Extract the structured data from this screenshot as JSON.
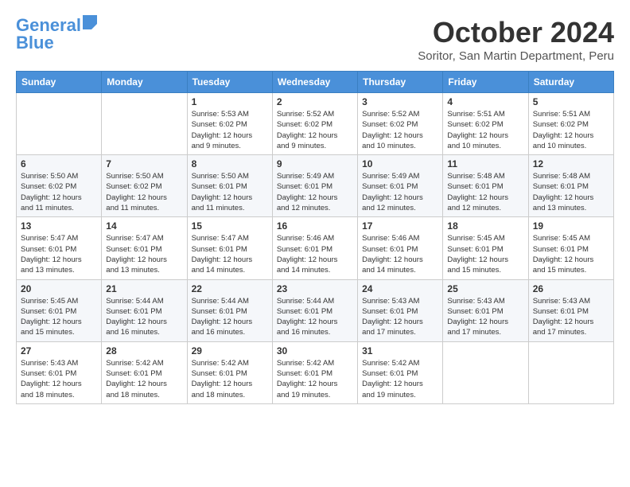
{
  "header": {
    "logo_line1": "General",
    "logo_line2": "Blue",
    "month_title": "October 2024",
    "subtitle": "Soritor, San Martin Department, Peru"
  },
  "weekdays": [
    "Sunday",
    "Monday",
    "Tuesday",
    "Wednesday",
    "Thursday",
    "Friday",
    "Saturday"
  ],
  "weeks": [
    [
      {
        "day": "",
        "info": ""
      },
      {
        "day": "",
        "info": ""
      },
      {
        "day": "1",
        "info": "Sunrise: 5:53 AM\nSunset: 6:02 PM\nDaylight: 12 hours\nand 9 minutes."
      },
      {
        "day": "2",
        "info": "Sunrise: 5:52 AM\nSunset: 6:02 PM\nDaylight: 12 hours\nand 9 minutes."
      },
      {
        "day": "3",
        "info": "Sunrise: 5:52 AM\nSunset: 6:02 PM\nDaylight: 12 hours\nand 10 minutes."
      },
      {
        "day": "4",
        "info": "Sunrise: 5:51 AM\nSunset: 6:02 PM\nDaylight: 12 hours\nand 10 minutes."
      },
      {
        "day": "5",
        "info": "Sunrise: 5:51 AM\nSunset: 6:02 PM\nDaylight: 12 hours\nand 10 minutes."
      }
    ],
    [
      {
        "day": "6",
        "info": "Sunrise: 5:50 AM\nSunset: 6:02 PM\nDaylight: 12 hours\nand 11 minutes."
      },
      {
        "day": "7",
        "info": "Sunrise: 5:50 AM\nSunset: 6:02 PM\nDaylight: 12 hours\nand 11 minutes."
      },
      {
        "day": "8",
        "info": "Sunrise: 5:50 AM\nSunset: 6:01 PM\nDaylight: 12 hours\nand 11 minutes."
      },
      {
        "day": "9",
        "info": "Sunrise: 5:49 AM\nSunset: 6:01 PM\nDaylight: 12 hours\nand 12 minutes."
      },
      {
        "day": "10",
        "info": "Sunrise: 5:49 AM\nSunset: 6:01 PM\nDaylight: 12 hours\nand 12 minutes."
      },
      {
        "day": "11",
        "info": "Sunrise: 5:48 AM\nSunset: 6:01 PM\nDaylight: 12 hours\nand 12 minutes."
      },
      {
        "day": "12",
        "info": "Sunrise: 5:48 AM\nSunset: 6:01 PM\nDaylight: 12 hours\nand 13 minutes."
      }
    ],
    [
      {
        "day": "13",
        "info": "Sunrise: 5:47 AM\nSunset: 6:01 PM\nDaylight: 12 hours\nand 13 minutes."
      },
      {
        "day": "14",
        "info": "Sunrise: 5:47 AM\nSunset: 6:01 PM\nDaylight: 12 hours\nand 13 minutes."
      },
      {
        "day": "15",
        "info": "Sunrise: 5:47 AM\nSunset: 6:01 PM\nDaylight: 12 hours\nand 14 minutes."
      },
      {
        "day": "16",
        "info": "Sunrise: 5:46 AM\nSunset: 6:01 PM\nDaylight: 12 hours\nand 14 minutes."
      },
      {
        "day": "17",
        "info": "Sunrise: 5:46 AM\nSunset: 6:01 PM\nDaylight: 12 hours\nand 14 minutes."
      },
      {
        "day": "18",
        "info": "Sunrise: 5:45 AM\nSunset: 6:01 PM\nDaylight: 12 hours\nand 15 minutes."
      },
      {
        "day": "19",
        "info": "Sunrise: 5:45 AM\nSunset: 6:01 PM\nDaylight: 12 hours\nand 15 minutes."
      }
    ],
    [
      {
        "day": "20",
        "info": "Sunrise: 5:45 AM\nSunset: 6:01 PM\nDaylight: 12 hours\nand 15 minutes."
      },
      {
        "day": "21",
        "info": "Sunrise: 5:44 AM\nSunset: 6:01 PM\nDaylight: 12 hours\nand 16 minutes."
      },
      {
        "day": "22",
        "info": "Sunrise: 5:44 AM\nSunset: 6:01 PM\nDaylight: 12 hours\nand 16 minutes."
      },
      {
        "day": "23",
        "info": "Sunrise: 5:44 AM\nSunset: 6:01 PM\nDaylight: 12 hours\nand 16 minutes."
      },
      {
        "day": "24",
        "info": "Sunrise: 5:43 AM\nSunset: 6:01 PM\nDaylight: 12 hours\nand 17 minutes."
      },
      {
        "day": "25",
        "info": "Sunrise: 5:43 AM\nSunset: 6:01 PM\nDaylight: 12 hours\nand 17 minutes."
      },
      {
        "day": "26",
        "info": "Sunrise: 5:43 AM\nSunset: 6:01 PM\nDaylight: 12 hours\nand 17 minutes."
      }
    ],
    [
      {
        "day": "27",
        "info": "Sunrise: 5:43 AM\nSunset: 6:01 PM\nDaylight: 12 hours\nand 18 minutes."
      },
      {
        "day": "28",
        "info": "Sunrise: 5:42 AM\nSunset: 6:01 PM\nDaylight: 12 hours\nand 18 minutes."
      },
      {
        "day": "29",
        "info": "Sunrise: 5:42 AM\nSunset: 6:01 PM\nDaylight: 12 hours\nand 18 minutes."
      },
      {
        "day": "30",
        "info": "Sunrise: 5:42 AM\nSunset: 6:01 PM\nDaylight: 12 hours\nand 19 minutes."
      },
      {
        "day": "31",
        "info": "Sunrise: 5:42 AM\nSunset: 6:01 PM\nDaylight: 12 hours\nand 19 minutes."
      },
      {
        "day": "",
        "info": ""
      },
      {
        "day": "",
        "info": ""
      }
    ]
  ]
}
